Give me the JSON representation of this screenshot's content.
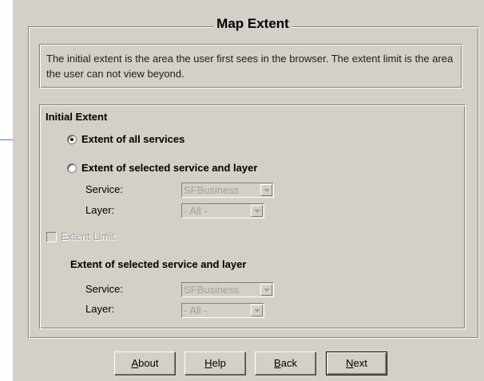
{
  "dialog": {
    "title": "Map Extent",
    "description": "The initial extent is the area the user first sees in the browser. The extent limit is the area the user can not view beyond."
  },
  "initial_extent": {
    "heading": "Initial Extent",
    "option_all_label": "Extent of all services",
    "option_all_selected": true,
    "option_selected_label": "Extent of selected service and layer",
    "option_selected_selected": false,
    "service_label": "Service:",
    "service_value": "SFBusiness",
    "layer_label": "Layer:",
    "layer_value": "- All -"
  },
  "extent_limit": {
    "checkbox_label": "Extent Limit",
    "checked": false,
    "heading": "Extent of selected service and layer",
    "service_label": "Service:",
    "service_value": "SFBusiness",
    "layer_label": "Layer:",
    "layer_value": "- All -"
  },
  "buttons": {
    "about": {
      "first": "A",
      "rest": "bout"
    },
    "help": {
      "first": "H",
      "rest": "elp"
    },
    "back": {
      "first": "B",
      "rest": "ack"
    },
    "next": {
      "first": "N",
      "rest": "ext"
    }
  },
  "colors": {
    "panel_bg": "#d4d0c8",
    "callout_line": "#5a7eb0",
    "disabled_text": "#a0a0a0"
  }
}
